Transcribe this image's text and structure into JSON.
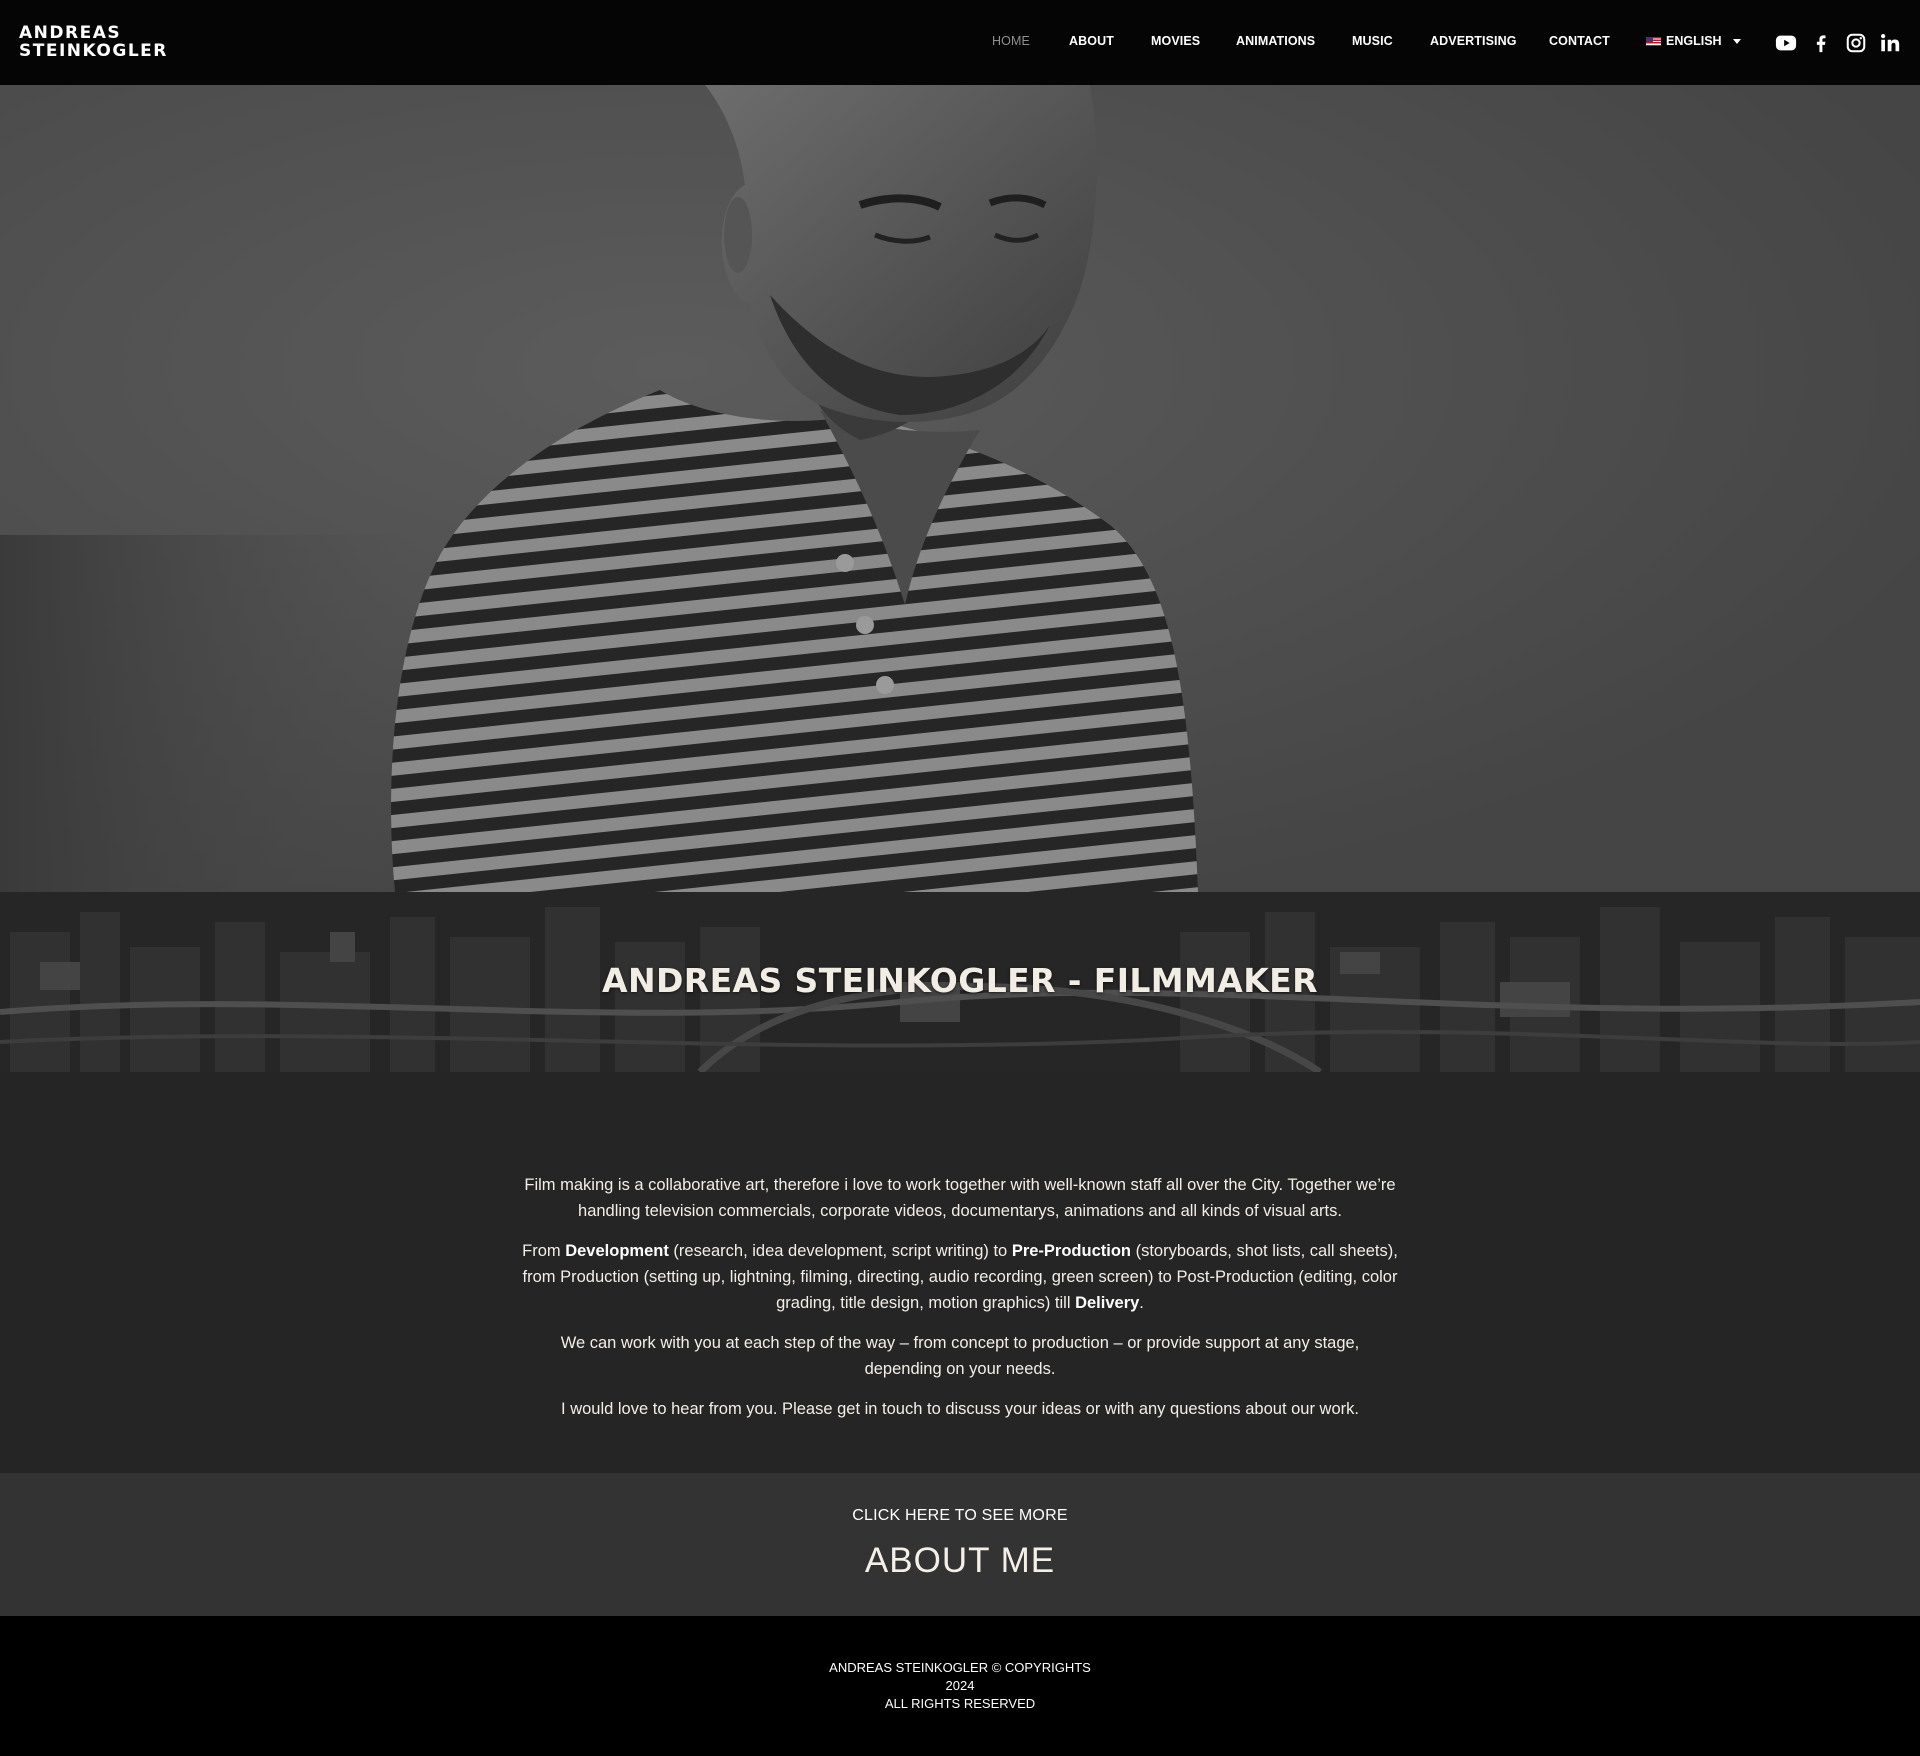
{
  "header": {
    "logo_line1": "ANDREAS",
    "logo_line2": "STEINKOGLER",
    "nav": [
      {
        "label": "HOME",
        "active": true
      },
      {
        "label": "ABOUT",
        "active": false
      },
      {
        "label": "MOVIES",
        "active": false
      },
      {
        "label": "ANIMATIONS",
        "active": false
      },
      {
        "label": "MUSIC",
        "active": false
      },
      {
        "label": "ADVERTISING",
        "active": false
      },
      {
        "label": "CONTACT",
        "active": false
      }
    ],
    "language": {
      "label": "ENGLISH",
      "flag_icon": "us-flag-icon"
    },
    "social": [
      "youtube-icon",
      "facebook-icon",
      "instagram-icon",
      "linkedin-icon"
    ]
  },
  "hero": {
    "title": "ANDREAS STEINKOGLER - FILMMAKER"
  },
  "intro": {
    "p1": "Film making is a collaborative art, therefore i love to work together with well-known staff all over the City. Together we’re handling television commercials, corporate videos, documentarys, animations and all kinds of visual arts.",
    "p2_a": "From ",
    "p2_b": "Development",
    "p2_c": " (research, idea development, script writing) to ",
    "p2_d": "Pre-Production",
    "p2_e": " (storyboards, shot lists, call sheets), from Production (setting up, lightning, filming, directing, audio recording, green screen) to Post-Production (editing, color grading, title design, motion graphics) till ",
    "p2_f": "Delivery",
    "p2_g": ".",
    "p3": "We can work with you at each step of the way – from concept to production – or provide support at any stage, depending on your needs.",
    "p4": "I would love to hear from you. Please get in touch to discuss your ideas or with any questions about our work."
  },
  "cta": {
    "small": "CLICK HERE TO SEE MORE",
    "big": "ABOUT ME"
  },
  "footer": {
    "line1": "ANDREAS STEINKOGLER © COPYRIGHTS",
    "line2": "2024",
    "line3": "ALL RIGHTS RESERVED"
  },
  "colors": {
    "header_bg": "#050505",
    "text_section_bg": "#252525",
    "cta_bg": "#333333",
    "footer_bg": "#000000",
    "active_nav": "#8f8f8f"
  }
}
